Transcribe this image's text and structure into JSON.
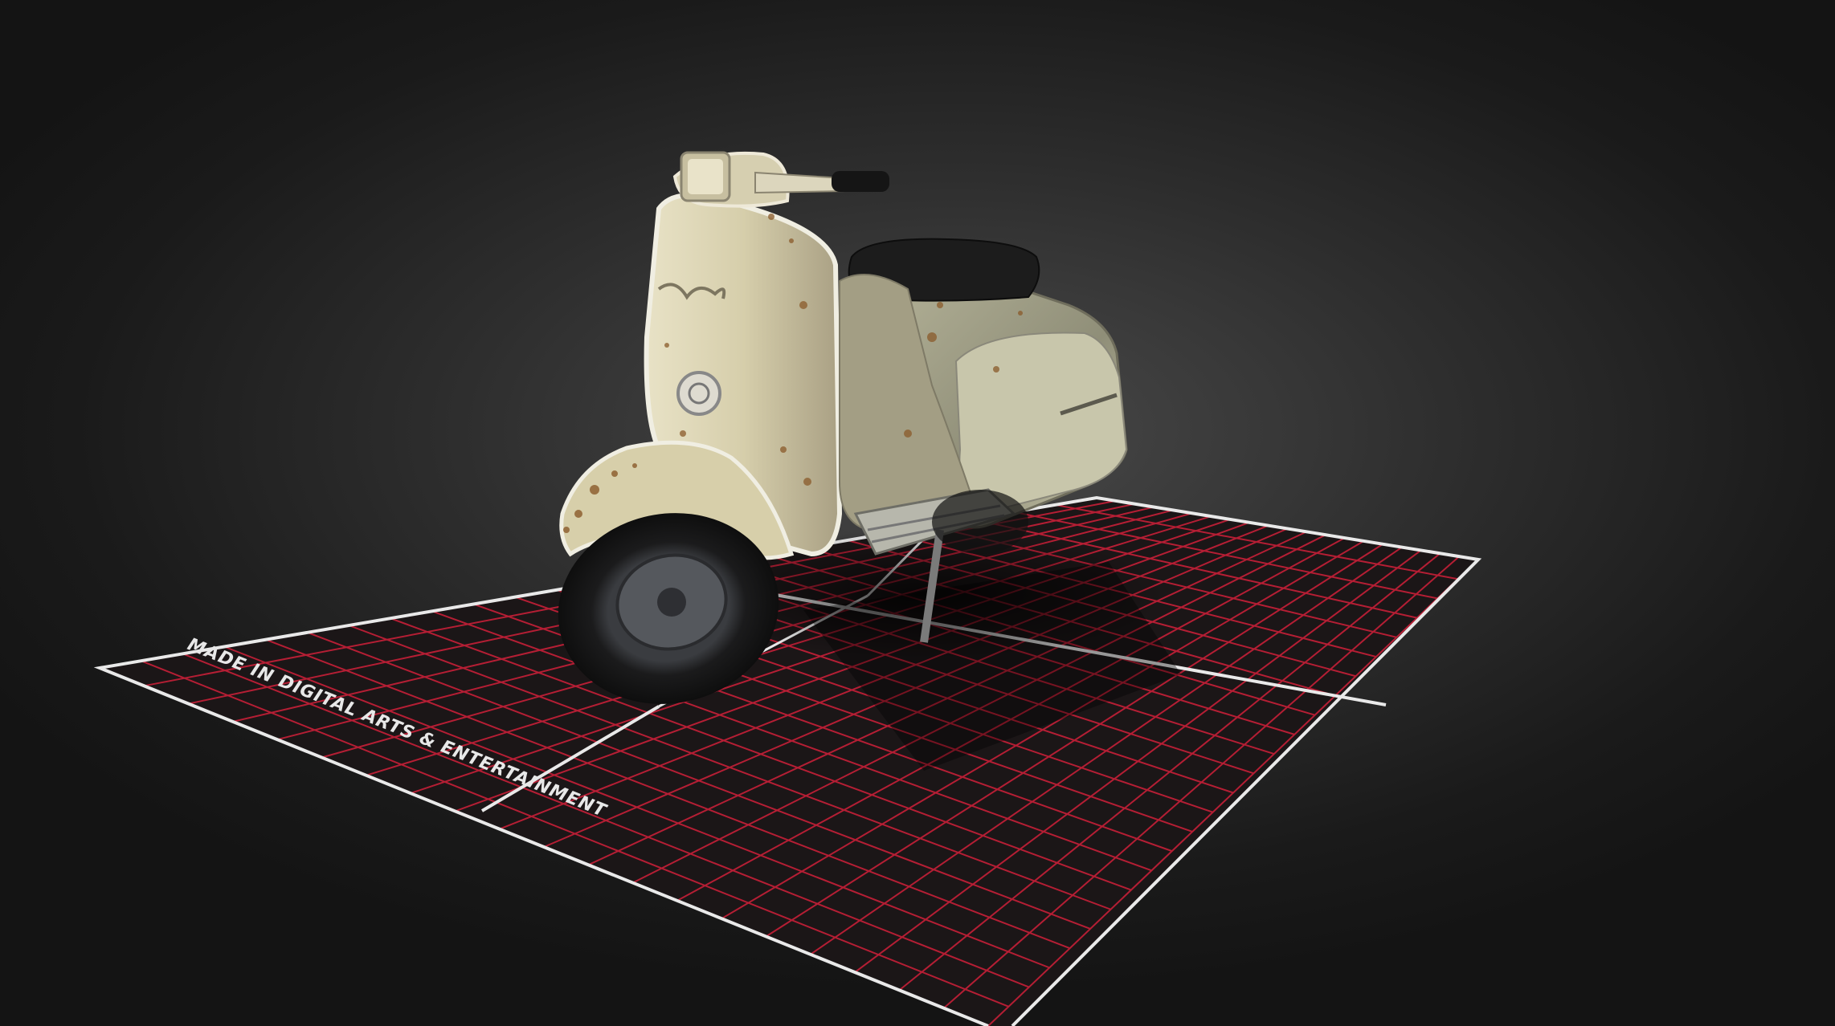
{
  "floor_label": "MADE IN DIGITAL ARTS & ENTERTAINMENT",
  "colors": {
    "grid_line": "#d0203a",
    "floor_border": "#e9e9e9",
    "scooter_body": "#d9d1ae",
    "seat": "#1c1c1c"
  },
  "icons": {
    "scooter": "scooter-model"
  }
}
